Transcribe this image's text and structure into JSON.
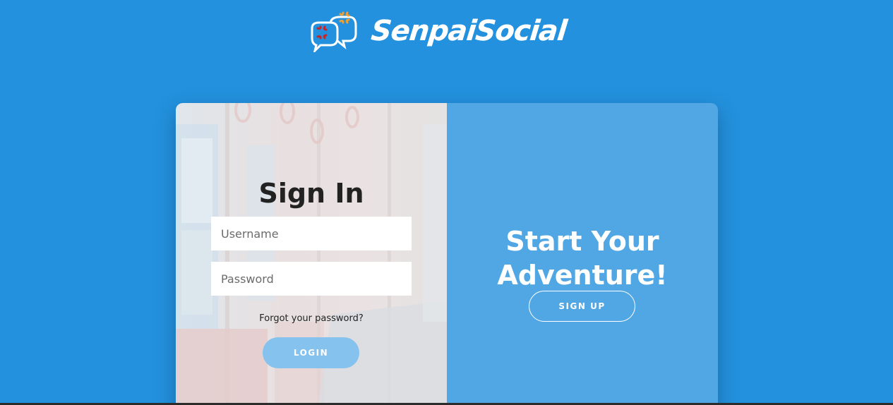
{
  "brand": {
    "name": "SenpaiSocial",
    "logo_icon": "anger-speech-bubbles-icon"
  },
  "signin": {
    "title": "Sign In",
    "username_placeholder": "Username",
    "password_placeholder": "Password",
    "forgot_label": "Forgot your password?",
    "login_label": "LOGIN"
  },
  "signup": {
    "headline": "Start Your Adventure!",
    "button_label": "SIGN UP"
  },
  "colors": {
    "background": "#2391de",
    "right_panel": "#51a6e4",
    "login_button": "#86c2ee",
    "title_text": "#222222"
  }
}
